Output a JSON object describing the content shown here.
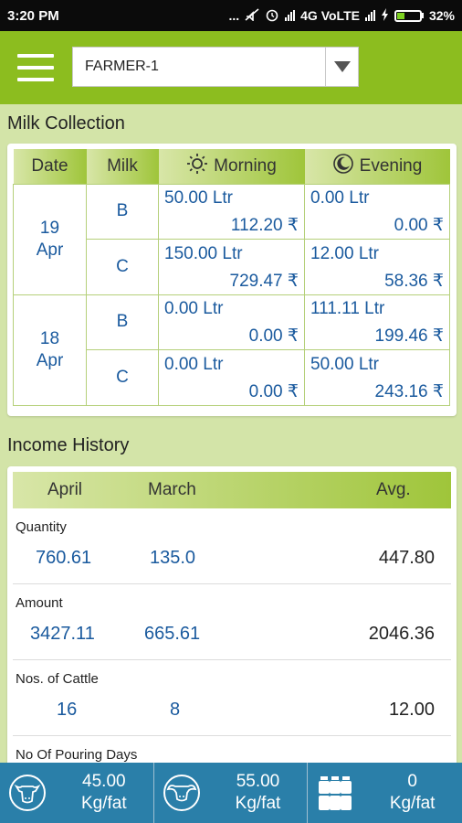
{
  "status_bar": {
    "time": "3:20 PM",
    "indicators": "... ",
    "network": "4G VoLTE",
    "battery": "32%",
    "battery_level": 0.32
  },
  "header": {
    "farmer_selected": "FARMER-1"
  },
  "milk_collection": {
    "title": "Milk Collection",
    "columns": {
      "date": "Date",
      "milk": "Milk",
      "morning": "Morning",
      "evening": "Evening"
    },
    "days": [
      {
        "day": "19",
        "month": "Apr",
        "rows": [
          {
            "milk": "B",
            "morning_ltr": "50.00 Ltr",
            "morning_amt": "112.20 ₹",
            "evening_ltr": "0.00 Ltr",
            "evening_amt": "0.00 ₹"
          },
          {
            "milk": "C",
            "morning_ltr": "150.00 Ltr",
            "morning_amt": "729.47 ₹",
            "evening_ltr": "12.00 Ltr",
            "evening_amt": "58.36 ₹"
          }
        ]
      },
      {
        "day": "18",
        "month": "Apr",
        "rows": [
          {
            "milk": "B",
            "morning_ltr": "0.00 Ltr",
            "morning_amt": "0.00 ₹",
            "evening_ltr": "111.11 Ltr",
            "evening_amt": "199.46 ₹"
          },
          {
            "milk": "C",
            "morning_ltr": "0.00 Ltr",
            "morning_amt": "0.00 ₹",
            "evening_ltr": "50.00 Ltr",
            "evening_amt": "243.16 ₹"
          }
        ]
      }
    ]
  },
  "income_history": {
    "title": "Income History",
    "columns": {
      "april": "April",
      "march": "March",
      "avg": "Avg."
    },
    "rows": [
      {
        "label": "Quantity",
        "april": "760.61",
        "march": "135.0",
        "avg": "447.80"
      },
      {
        "label": "Amount",
        "april": "3427.11",
        "march": "665.61",
        "avg": "2046.36"
      },
      {
        "label": "Nos. of Cattle",
        "april": "16",
        "march": "8",
        "avg": "12.00"
      },
      {
        "label": "No Of Pouring Days",
        "april": "",
        "march": "",
        "avg": ""
      }
    ]
  },
  "bottom_bar": [
    {
      "icon": "cow-icon",
      "value": "45.00",
      "unit": "Kg/fat"
    },
    {
      "icon": "buffalo-icon",
      "value": "55.00",
      "unit": "Kg/fat"
    },
    {
      "icon": "milk-cans-icon",
      "value": "0",
      "unit": "Kg/fat"
    }
  ]
}
